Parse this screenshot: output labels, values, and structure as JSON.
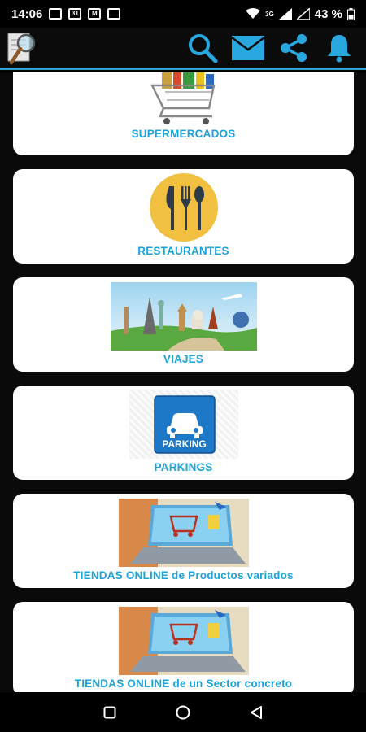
{
  "status_bar": {
    "time": "14:06",
    "battery": "43 %",
    "network": "3G"
  },
  "categories": [
    {
      "label": "SUPERMERCADOS",
      "icon": "shopping-cart-icon"
    },
    {
      "label": "RESTAURANTES",
      "icon": "cutlery-icon"
    },
    {
      "label": "VIAJES",
      "icon": "world-landmarks-image"
    },
    {
      "label": "PARKINGS",
      "icon": "parking-sign-icon",
      "sign_text": "PARKING"
    },
    {
      "label": "TIENDAS ONLINE de Productos variados",
      "icon": "online-shopping-image"
    },
    {
      "label": "TIENDAS ONLINE de un Sector concreto",
      "icon": "online-shopping-image"
    }
  ],
  "colors": {
    "accent": "#1aa3dc",
    "app_bar_icons": "#29a8e0",
    "restaurant_circle": "#f2c040",
    "parking_blue": "#1e78c8"
  }
}
